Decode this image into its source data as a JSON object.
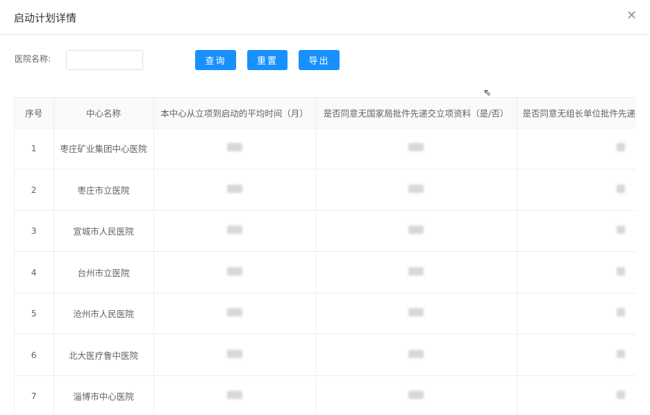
{
  "dialog": {
    "title": "启动计划详情",
    "close_icon": "close-icon"
  },
  "filter": {
    "label": "医院名称:",
    "input_value": "",
    "input_placeholder": ""
  },
  "buttons": {
    "query": "查询",
    "reset": "重置",
    "export": "导出"
  },
  "table": {
    "columns": [
      "序号",
      "中心名称",
      "本中心从立项到启动的平均时间（月）",
      "是否同意无国家局批件先递交立项资料（是/否）",
      "是否同意无组长单位批件先递"
    ],
    "rows": [
      {
        "index": "1",
        "name": "枣庄矿业集团中心医院"
      },
      {
        "index": "2",
        "name": "枣庄市立医院"
      },
      {
        "index": "3",
        "name": "宣城市人民医院"
      },
      {
        "index": "4",
        "name": "台州市立医院"
      },
      {
        "index": "5",
        "name": "沧州市人民医院"
      },
      {
        "index": "6",
        "name": "北大医疗鲁中医院"
      },
      {
        "index": "7",
        "name": "淄博市中心医院"
      }
    ]
  }
}
